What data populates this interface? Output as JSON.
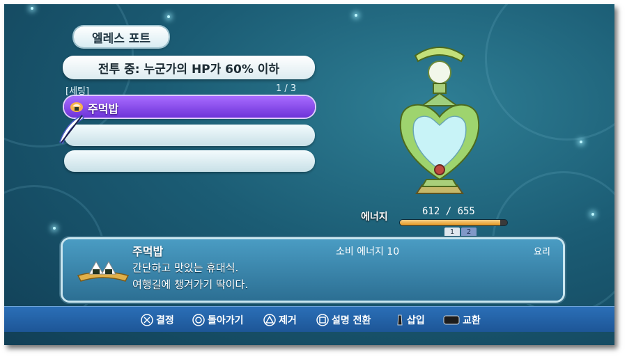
{
  "menu_title": "엘레스 포트",
  "condition": "전투 중: 누군가의 HP가 60% 이하",
  "settings": {
    "label": "[세팅]",
    "page": "1 / 3"
  },
  "slots": [
    {
      "label": "주먹밥",
      "selected": true,
      "icon": "rice-ball-icon"
    },
    {
      "label": "",
      "selected": false
    },
    {
      "label": ""
    }
  ],
  "energy": {
    "label": "에너지",
    "value": "612 / 655",
    "current": 612,
    "max": 655
  },
  "pages": [
    "1",
    "2"
  ],
  "item": {
    "name": "주먹밥",
    "cost": "소비 에너지 10",
    "category": "요리",
    "description": [
      "간단하고 맛있는 휴대식.",
      "여행길에 챙겨가기 딱이다."
    ]
  },
  "controls": [
    {
      "icon": "cross-button-icon",
      "label": "결정"
    },
    {
      "icon": "circle-button-icon",
      "label": "돌아가기"
    },
    {
      "icon": "triangle-button-icon",
      "label": "제거"
    },
    {
      "icon": "square-button-icon",
      "label": "설명 전환"
    },
    {
      "icon": "r-stick-icon",
      "label": "삽입"
    },
    {
      "icon": "touchpad-icon",
      "label": "교환"
    }
  ],
  "colors": {
    "selected_slot": "#7a3ee6",
    "energy_fill": "#e3951f",
    "bottom_bar": "#2263a8"
  }
}
